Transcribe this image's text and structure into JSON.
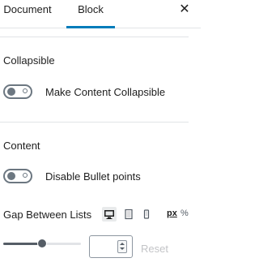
{
  "tabs": {
    "document": "Document",
    "block": "Block",
    "active": "Block",
    "close_icon": "close-icon"
  },
  "colors": {
    "accent": "#007cba",
    "toggle_off": "#6c7781",
    "divider": "#e2e4e7",
    "disabled_text": "#c3c4c7"
  },
  "collapsible": {
    "heading": "Collapsible",
    "toggle_label": "Make Content Collapsible",
    "toggle_on": false
  },
  "content": {
    "heading": "Content",
    "toggle_label": "Disable Bullet points",
    "toggle_on": false
  },
  "gap": {
    "label": "Gap Between Lists",
    "devices": [
      "desktop-icon",
      "tablet-icon",
      "mobile-icon"
    ],
    "active_device": "desktop",
    "units": [
      "px",
      "%"
    ],
    "active_unit": "px",
    "slider_fraction": 0.5,
    "value": "",
    "reset_label": "Reset"
  }
}
